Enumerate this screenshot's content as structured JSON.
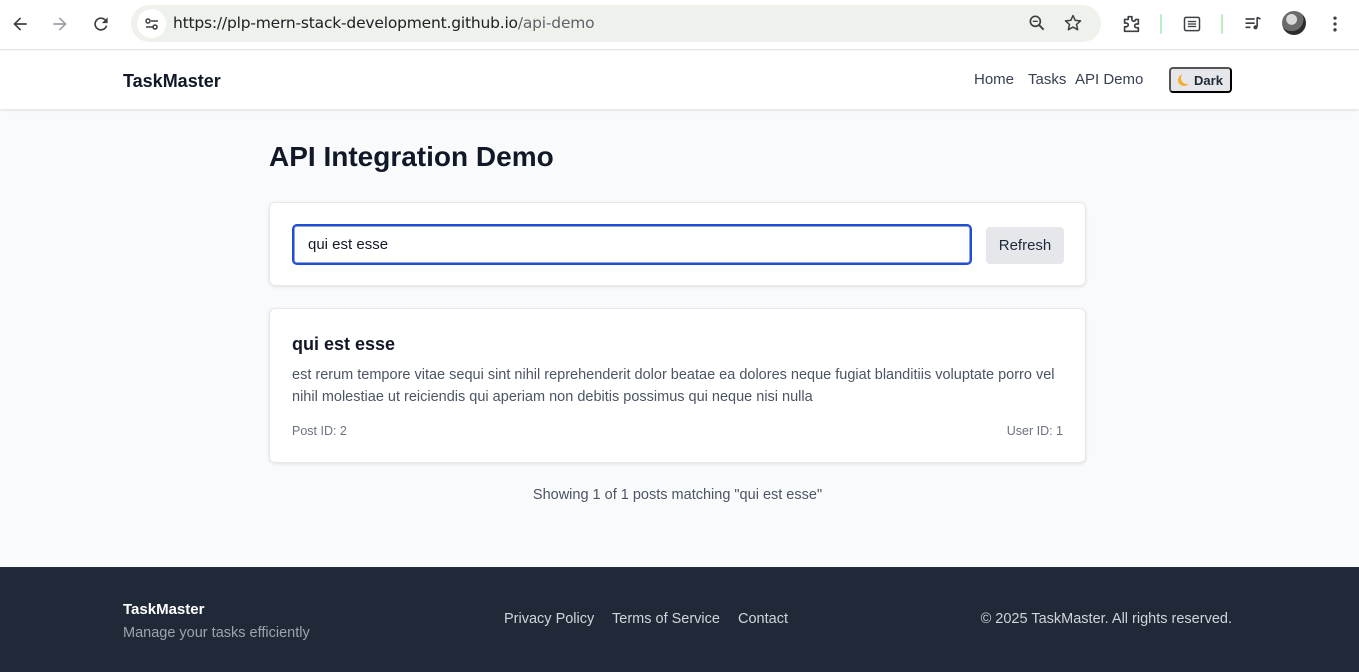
{
  "browser": {
    "url_host": "https://plp-mern-stack-development.github.io",
    "url_path": "/api-demo",
    "icons": [
      "back-arrow-icon",
      "forward-arrow-icon",
      "reload-icon",
      "site-info-icon",
      "zoom-icon",
      "star-icon",
      "extensions-icon",
      "reading-list-icon",
      "media-control-icon",
      "profile-avatar",
      "more-menu-icon"
    ]
  },
  "header": {
    "brand": "TaskMaster",
    "nav": {
      "home": "Home",
      "tasks": "Tasks",
      "api_demo": "API Demo"
    },
    "theme_toggle": "Dark"
  },
  "main": {
    "title": "API Integration Demo",
    "search": {
      "value": "qui est esse",
      "refresh_label": "Refresh"
    },
    "posts": [
      {
        "title": "qui est esse",
        "body": "est rerum tempore vitae sequi sint nihil reprehenderit dolor beatae ea dolores neque fugiat blanditiis voluptate porro vel nihil molestiae ut reiciendis qui aperiam non debitis possimus qui neque nisi nulla",
        "post_id": "Post ID: 2",
        "user_id": "User ID: 1"
      }
    ],
    "results_summary": "Showing 1 of 1 posts matching \"qui est esse\""
  },
  "footer": {
    "brand": "TaskMaster",
    "tagline": "Manage your tasks efficiently",
    "links": {
      "privacy": "Privacy Policy",
      "terms": "Terms of Service",
      "contact": "Contact"
    },
    "copyright": "© 2025 TaskMaster. All rights reserved."
  },
  "colors": {
    "accent": "#1d4ed8",
    "page_bg": "#f9fafb",
    "footer_bg": "#1f2937"
  }
}
